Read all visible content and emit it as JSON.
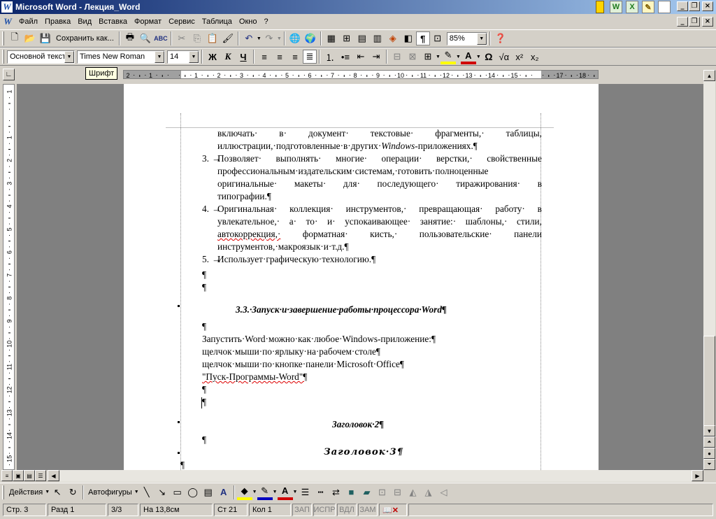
{
  "window": {
    "title": "Microsoft Word - Лекция_Word",
    "app_icon": "W"
  },
  "office_icons": [
    "W",
    "X",
    "",
    "",
    ""
  ],
  "menu": [
    {
      "label": "Файл"
    },
    {
      "label": "Правка"
    },
    {
      "label": "Вид"
    },
    {
      "label": "Вставка"
    },
    {
      "label": "Формат"
    },
    {
      "label": "Сервис"
    },
    {
      "label": "Таблица"
    },
    {
      "label": "Окно"
    },
    {
      "label": "?"
    }
  ],
  "standard_toolbar": {
    "save_as_label": "Сохранить как...",
    "zoom": "85%"
  },
  "format_toolbar": {
    "style": "Основной текст",
    "font": "Times New Roman",
    "size": "14",
    "bold": "Ж",
    "italic": "К",
    "underline": "Ч"
  },
  "tooltip": "Шрифт",
  "hruler_numbers": [
    "2",
    "1",
    "",
    "1",
    "2",
    "3",
    "4",
    "5",
    "6",
    "7",
    "8",
    "9",
    "10",
    "11",
    "12",
    "13",
    "14",
    "15",
    "",
    "17",
    "18"
  ],
  "vruler_numbers": [
    "1",
    "",
    "1",
    "2",
    "3",
    "4",
    "5",
    "6",
    "7",
    "8",
    "9",
    "10",
    "11",
    "12",
    "13",
    "14",
    "15"
  ],
  "document": {
    "l1": [
      "включать·",
      "в·",
      "документ·",
      "текстовые·",
      "фрагменты,·",
      "таблицы,"
    ],
    "l2": "иллюстрации,·подготовленные·в·других·",
    "l2_italic": "Windows",
    "l2_end": "-приложениях.¶",
    "l3_num": "3.",
    "l3": [
      "Позволяет·",
      "выполнять·",
      "многие·",
      "операции·",
      "верстки,·",
      "свойственные"
    ],
    "l4": [
      "профессиональным·издательским·системам,·готовить·полноценные"
    ],
    "l5": [
      "оригинальные·",
      "макеты·",
      "для·",
      "последующего·",
      "тиражирования·",
      "в"
    ],
    "l6": "типографии.¶",
    "l7_num": "4.",
    "l7": [
      "Оригинальная·",
      "коллекция·",
      "инструментов,·",
      "превращающая·",
      "работу·",
      "в"
    ],
    "l8": [
      "увлекательное,·",
      "а·",
      "то·",
      "и·",
      "успокаивающее·",
      "занятие:·",
      "шаблоны,·",
      "стили,"
    ],
    "l9": [
      "автокоррекция,·",
      "форматная·",
      "кисть,·",
      "пользовательские·",
      "панели"
    ],
    "l10": "инструментов,·макроязык·и·т.д.¶",
    "l11_num": "5.",
    "l11": "Использует·графическую·технологию.¶",
    "para": "¶",
    "heading33": "3.3.·Запуск·и·завершение·работы·процессора·Word¶",
    "p1": "Запустить·Word·можно·как·любое·Windows-приложение:¶",
    "p2": "щелчок·мыши·по·ярлыку·на·рабочем·столе¶",
    "p3": "щелчок·мыши·по·кнопке·панели·Microsoft·Office¶",
    "p4": "\"Пуск-Программы-Word\"¶",
    "h2": "Заголовок·2¶",
    "h3": "Заголовок·3¶"
  },
  "draw_toolbar": {
    "actions": "Действия",
    "autoshapes": "Автофигуры"
  },
  "status": {
    "page": "Стр. 3",
    "section": "Разд 1",
    "pages": "3/3",
    "at": "На 13,8см",
    "line": "Ст 21",
    "col": "Кол 1",
    "rec": "ЗАП",
    "trk": "ИСПР",
    "ext": "ВДЛ",
    "ovr": "ЗАМ"
  },
  "colors": {
    "titlebar": "#0a246a",
    "face": "#d4d0c8",
    "workspace": "#808080"
  }
}
